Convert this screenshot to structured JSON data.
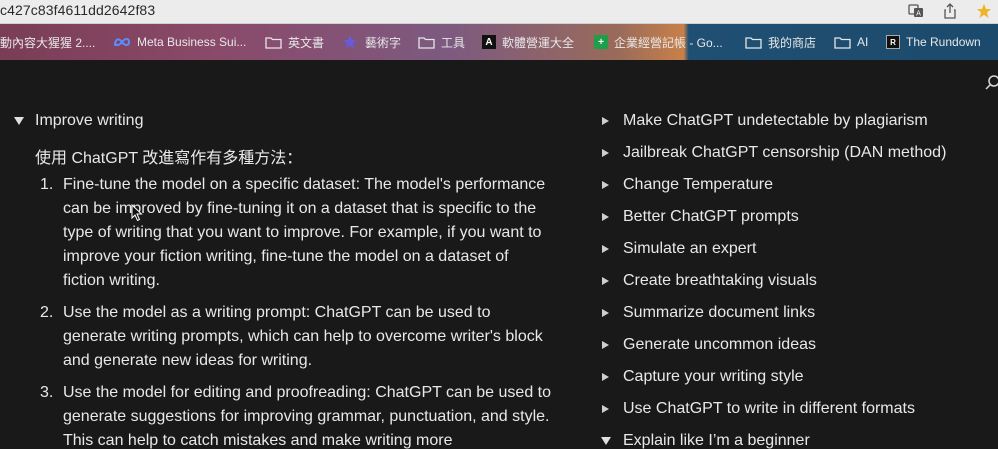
{
  "browser": {
    "url_fragment": "c427c83f4611dd2642f83"
  },
  "bookmarks": [
    {
      "label": "動內容大猩猩 2....",
      "icon": "none"
    },
    {
      "label": "Meta Business Sui...",
      "icon": "meta-icon"
    },
    {
      "label": "英文書",
      "icon": "folder-icon"
    },
    {
      "label": "藝術字",
      "icon": "star-icon"
    },
    {
      "label": "工具",
      "icon": "folder-icon"
    },
    {
      "label": "軟體營運大全",
      "icon": "a-square-icon"
    },
    {
      "label": "企業經營記帳 - Go...",
      "icon": "sheets-icon"
    },
    {
      "label": "我的商店",
      "icon": "folder-icon"
    },
    {
      "label": "AI",
      "icon": "folder-icon"
    },
    {
      "label": "The Rundown",
      "icon": "r-square-icon"
    }
  ],
  "left": {
    "toggle_title": "Improve writing",
    "intro": "使用 ChatGPT 改進寫作有多種方法：",
    "items": [
      {
        "num": "1.",
        "text": "Fine-tune the model on a specific dataset: The model's performance can be improved by fine-tuning it on a dataset that is specific to the type of writing that you want to improve. For example, if you want to improve your fiction writing, fine-tune the model on a dataset of fiction writing."
      },
      {
        "num": "2.",
        "text": "Use the model as a writing prompt: ChatGPT can be used to generate writing prompts, which can help to overcome writer's block and generate new ideas for writing."
      },
      {
        "num": "3.",
        "text": "Use the model for editing and proofreading: ChatGPT can be used to generate suggestions for improving grammar, punctuation, and style. This can help to catch mistakes and make writing more"
      }
    ]
  },
  "right": {
    "toggles": [
      {
        "label": "Make ChatGPT undetectable by plagiarism",
        "open": false
      },
      {
        "label": "Jailbreak ChatGPT censorship (DAN method)",
        "open": false
      },
      {
        "label": "Change Temperature",
        "open": false
      },
      {
        "label": "Better ChatGPT prompts",
        "open": false
      },
      {
        "label": "Simulate an expert",
        "open": false
      },
      {
        "label": "Create breathtaking visuals",
        "open": false
      },
      {
        "label": "Summarize document links",
        "open": false
      },
      {
        "label": "Generate uncommon ideas",
        "open": false
      },
      {
        "label": "Capture your writing style",
        "open": false
      },
      {
        "label": "Use ChatGPT to write in different formats",
        "open": false
      },
      {
        "label": "Explain like I’m a beginner",
        "open": true
      }
    ]
  },
  "colors": {
    "background": "#191919",
    "text": "#e8e8e8",
    "bookmark_bar_left": "#7a3d55",
    "bookmark_bar_right": "#1c4a6c"
  }
}
